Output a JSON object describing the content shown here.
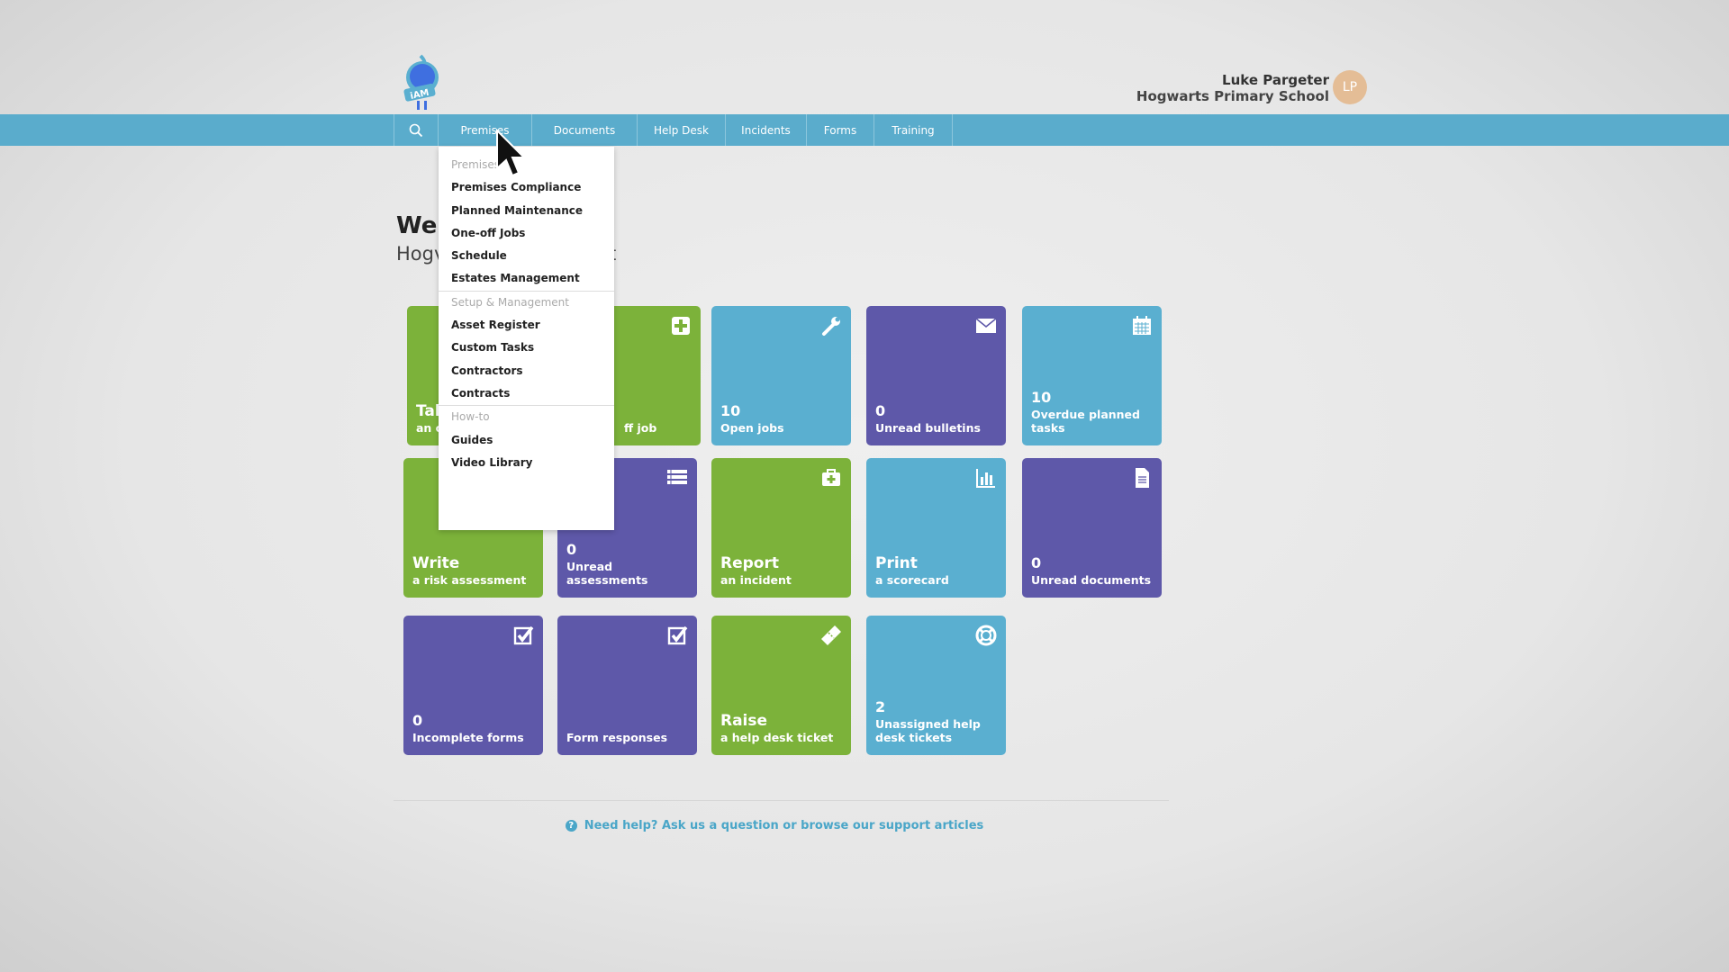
{
  "logo": {
    "text": "iAM"
  },
  "user": {
    "name": "Luke Pargeter",
    "school": "Hogwarts Primary School",
    "initials": "LP"
  },
  "nav": {
    "search_icon": "search-icon",
    "items": [
      "Premises",
      "Documents",
      "Help Desk",
      "Incidents",
      "Forms",
      "Training"
    ]
  },
  "welcome": {
    "title_fragment": "Wel",
    "subtitle_fragment": "Hogv",
    "subtitle_tail": "t"
  },
  "dropdown": [
    {
      "label": "Premises",
      "header": true
    },
    {
      "label": "Premises Compliance"
    },
    {
      "label": "Planned Maintenance"
    },
    {
      "label": "One-off Jobs"
    },
    {
      "label": "Schedule"
    },
    {
      "label": "Estates Management"
    },
    {
      "label": "Setup & Management",
      "header": true
    },
    {
      "label": "Asset Register"
    },
    {
      "label": "Custom Tasks"
    },
    {
      "label": "Contractors"
    },
    {
      "label": "Contracts"
    },
    {
      "label": "How-to",
      "header": true
    },
    {
      "label": "Guides"
    },
    {
      "label": "Video Library"
    }
  ],
  "tiles": [
    {
      "big": "Tak",
      "label": "an c",
      "color": "green",
      "icon": ""
    },
    {
      "label": "ff job",
      "color": "green",
      "icon": "plus-square-icon"
    },
    {
      "num": "10",
      "label": "Open jobs",
      "color": "blue",
      "icon": "wrench-icon"
    },
    {
      "num": "0",
      "label": "Unread bulletins",
      "color": "purple",
      "icon": "envelope-icon"
    },
    {
      "num": "10",
      "label": "Overdue planned tasks",
      "color": "blue",
      "icon": "calendar-icon"
    },
    {
      "big": "Write",
      "label": "a risk assessment",
      "color": "green",
      "icon": ""
    },
    {
      "num": "0",
      "label": "Unread assessments",
      "color": "purple",
      "icon": "list-icon"
    },
    {
      "big": "Report",
      "label": "an incident",
      "color": "green",
      "icon": "medkit-icon"
    },
    {
      "big": "Print",
      "label": "a scorecard",
      "color": "blue",
      "icon": "bar-chart-icon"
    },
    {
      "num": "0",
      "label": "Unread documents",
      "color": "purple",
      "icon": "document-icon"
    },
    {
      "num": "0",
      "label": "Incomplete forms",
      "color": "purple",
      "icon": "checkbox-icon"
    },
    {
      "label": "Form responses",
      "color": "purple",
      "icon": "checkbox-icon"
    },
    {
      "big": "Raise",
      "label": "a help desk ticket",
      "color": "green",
      "icon": "ticket-icon"
    },
    {
      "num": "2",
      "label": "Unassigned help desk tickets",
      "color": "blue",
      "icon": "lifebuoy-icon"
    }
  ],
  "help": {
    "text": "Need help? Ask us a question or browse our support articles",
    "icon": "question-circle-icon"
  },
  "colors": {
    "green": "#7cb23a",
    "blue": "#5aafd0",
    "purple": "#5e58a9",
    "nav": "#5aaccc"
  }
}
